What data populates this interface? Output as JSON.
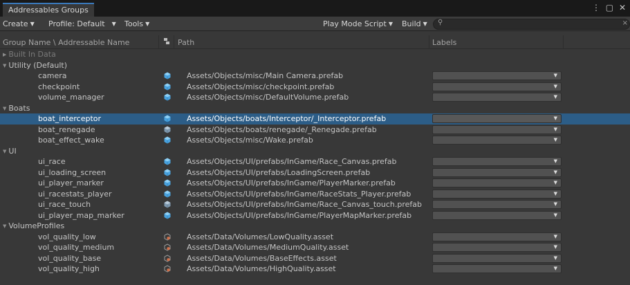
{
  "window": {
    "tab_title": "Addressables Groups",
    "menu_icon": "kebab-menu-icon",
    "maximize_icon": "maximize-icon",
    "close_icon": "close-icon"
  },
  "toolbar": {
    "create_label": "Create",
    "profile_label": "Profile: Default",
    "tools_label": "Tools",
    "play_mode_label": "Play Mode Script",
    "build_label": "Build",
    "search_placeholder": ""
  },
  "header": {
    "name_col": "Group Name \\ Addressable Name",
    "icon_col_icon": "asset-type-icon",
    "path_col": "Path",
    "labels_col": "Labels"
  },
  "groups": [
    {
      "name": "Built In Data",
      "expanded": false,
      "dim": true,
      "entries": []
    },
    {
      "name": "Utility (Default)",
      "expanded": true,
      "entries": [
        {
          "name": "camera",
          "icon": "prefab-icon",
          "path": "Assets/Objects/misc/Main Camera.prefab"
        },
        {
          "name": "checkpoint",
          "icon": "prefab-icon",
          "path": "Assets/Objects/misc/checkpoint.prefab"
        },
        {
          "name": "volume_manager",
          "icon": "prefab-icon",
          "path": "Assets/Objects/misc/DefaultVolume.prefab"
        }
      ]
    },
    {
      "name": "Boats",
      "expanded": true,
      "entries": [
        {
          "name": "boat_interceptor",
          "icon": "prefab-icon",
          "path": "Assets/Objects/boats/Interceptor/_Interceptor.prefab",
          "selected": true
        },
        {
          "name": "boat_renegade",
          "icon": "prefab-variant-icon",
          "path": "Assets/Objects/boats/renegade/_Renegade.prefab"
        },
        {
          "name": "boat_effect_wake",
          "icon": "prefab-icon",
          "path": "Assets/Objects/misc/Wake.prefab"
        }
      ]
    },
    {
      "name": "UI",
      "expanded": true,
      "entries": [
        {
          "name": "ui_race",
          "icon": "prefab-icon",
          "path": "Assets/Objects/UI/prefabs/InGame/Race_Canvas.prefab"
        },
        {
          "name": "ui_loading_screen",
          "icon": "prefab-icon",
          "path": "Assets/Objects/UI/prefabs/LoadingScreen.prefab"
        },
        {
          "name": "ui_player_marker",
          "icon": "prefab-icon",
          "path": "Assets/Objects/UI/prefabs/InGame/PlayerMarker.prefab"
        },
        {
          "name": "ui_racestats_player",
          "icon": "prefab-icon",
          "path": "Assets/Objects/UI/prefabs/InGame/RaceStats_Player.prefab"
        },
        {
          "name": "ui_race_touch",
          "icon": "prefab-variant-icon",
          "path": "Assets/Objects/UI/prefabs/InGame/Race_Canvas_touch.prefab"
        },
        {
          "name": "ui_player_map_marker",
          "icon": "prefab-icon",
          "path": "Assets/Objects/UI/prefabs/InGame/PlayerMapMarker.prefab"
        }
      ]
    },
    {
      "name": "VolumeProfiles",
      "expanded": true,
      "entries": [
        {
          "name": "vol_quality_low",
          "icon": "volume-profile-icon",
          "path": "Assets/Data/Volumes/LowQuality.asset"
        },
        {
          "name": "vol_quality_medium",
          "icon": "volume-profile-icon",
          "path": "Assets/Data/Volumes/MediumQuality.asset"
        },
        {
          "name": "vol_quality_base",
          "icon": "volume-profile-icon",
          "path": "Assets/Data/Volumes/BaseEffects.asset"
        },
        {
          "name": "vol_quality_high",
          "icon": "volume-profile-icon",
          "path": "Assets/Data/Volumes/HighQuality.asset"
        }
      ]
    }
  ],
  "colors": {
    "selection": "#2c5d87",
    "prefab_icon": "#4aa3df",
    "variant_icon": "#8aa9c4",
    "volume_icon": "#d0704a",
    "tab_accent": "#3a79bb"
  }
}
